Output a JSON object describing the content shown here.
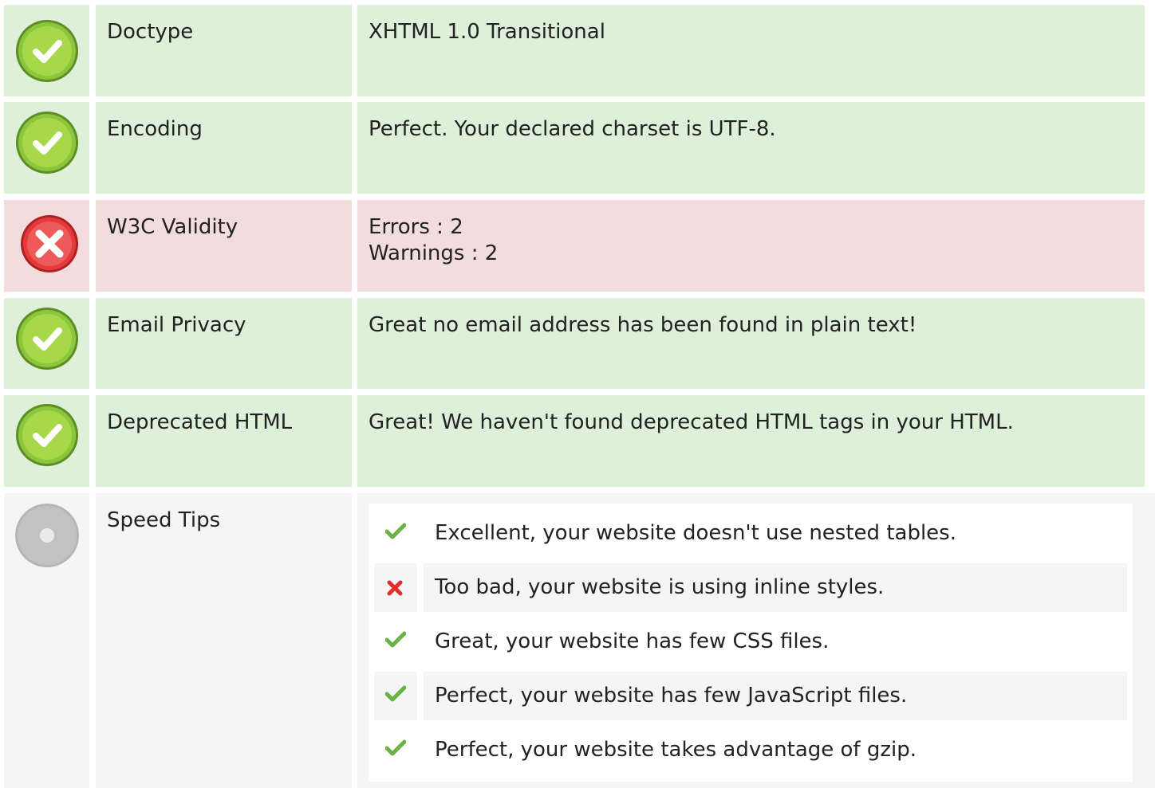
{
  "colors": {
    "ok_background": "#def0da",
    "error_background": "#f2dcde",
    "neutral_background": "#f5f5f5",
    "ok_icon": "#8cc63f",
    "error_icon": "#e33b3b",
    "neutral_icon": "#b5b5b5"
  },
  "checks": [
    {
      "status": "ok",
      "icon": "check-circle-icon",
      "label": "Doctype",
      "value_lines": [
        "XHTML 1.0 Transitional"
      ]
    },
    {
      "status": "ok",
      "icon": "check-circle-icon",
      "label": "Encoding",
      "value_lines": [
        "Perfect. Your declared charset is UTF-8."
      ]
    },
    {
      "status": "error",
      "icon": "cross-circle-icon",
      "label": "W3C Validity",
      "value_lines": [
        "Errors : 2",
        "Warnings : 2"
      ]
    },
    {
      "status": "ok",
      "icon": "check-circle-icon",
      "label": "Email Privacy",
      "value_lines": [
        "Great no email address has been found in plain text!"
      ]
    },
    {
      "status": "ok",
      "icon": "check-circle-icon",
      "label": "Deprecated HTML",
      "value_lines": [
        "Great! We haven't found deprecated HTML tags in your HTML."
      ]
    }
  ],
  "speed_tips": {
    "icon": "neutral-circle-icon",
    "label": "Speed Tips",
    "items": [
      {
        "status": "pass",
        "icon": "checkmark-icon",
        "text": "Excellent, your website doesn't use nested tables."
      },
      {
        "status": "fail",
        "icon": "cross-icon",
        "text": "Too bad, your website is using inline styles."
      },
      {
        "status": "pass",
        "icon": "checkmark-icon",
        "text": "Great, your website has few CSS files."
      },
      {
        "status": "pass",
        "icon": "checkmark-icon",
        "text": "Perfect, your website has few JavaScript files."
      },
      {
        "status": "pass",
        "icon": "checkmark-icon",
        "text": "Perfect, your website takes advantage of gzip."
      }
    ]
  }
}
